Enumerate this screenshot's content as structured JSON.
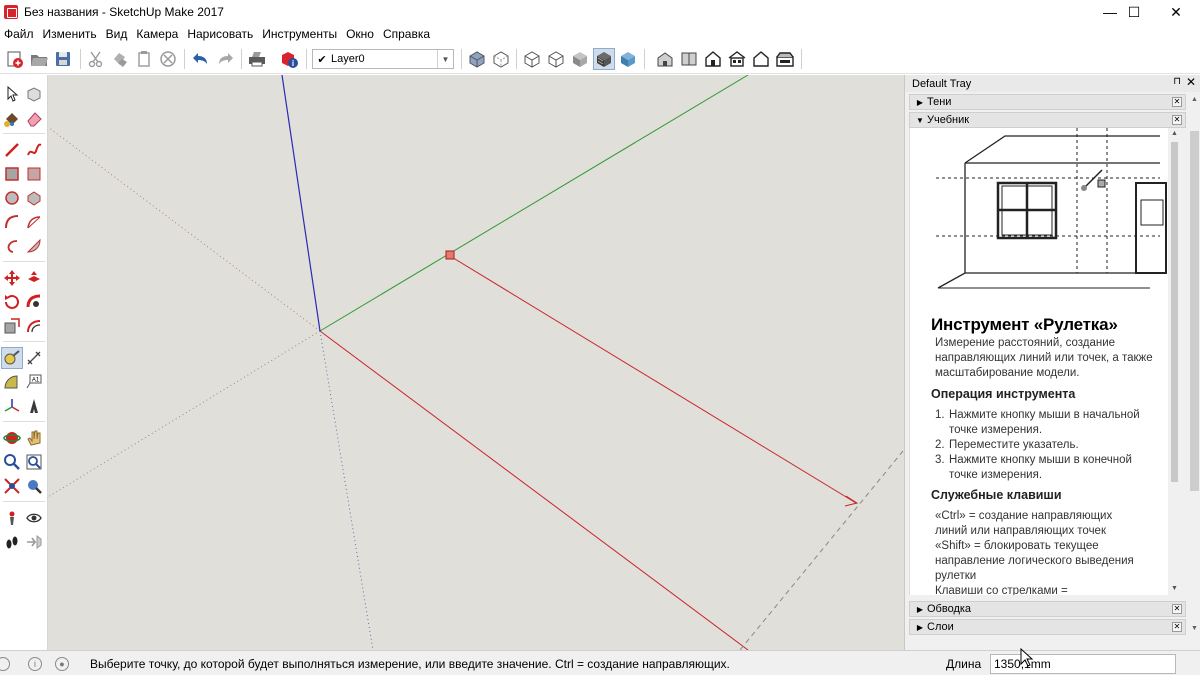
{
  "window": {
    "title": "Без названия - SketchUp Make 2017",
    "minimize": "—",
    "maximize": "☐",
    "close": "✕"
  },
  "menu": [
    "Файл",
    "Изменить",
    "Вид",
    "Камера",
    "Нарисовать",
    "Инструменты",
    "Окно",
    "Справка"
  ],
  "toolbar": {
    "layer_check": "✔",
    "layer_value": "Layer0",
    "layer_dropdown": "▼",
    "icons": [
      "new-file-icon",
      "open-file-icon",
      "save-icon",
      "cut-icon",
      "copy-icon",
      "paste-icon",
      "erase-icon",
      "undo-icon",
      "redo-icon",
      "print-icon",
      "model-info-icon",
      "xray-style-icon",
      "backedges-style-icon",
      "wireframe-style-icon",
      "hiddenline-style-icon",
      "shaded-style-icon",
      "shaded-textures-style-icon",
      "monochrome-style-icon",
      "iso-view-icon",
      "top-view-icon",
      "front-view-icon",
      "right-view-icon",
      "back-view-icon",
      "left-view-icon"
    ]
  },
  "tray": {
    "title": "Default Tray",
    "pin": "⊓",
    "close": "✕",
    "panels": {
      "shadows": "Тени",
      "instructor": "Учебник",
      "outline": "Обводка",
      "layers": "Слои"
    },
    "arrow_collapsed": "▶",
    "arrow_expanded": "▼",
    "panel_close": "✕"
  },
  "instructor": {
    "title": "Инструмент «Рулетка»",
    "description": "Измерение расстояний, создание направляющих линий или точек, а также масштабирование модели.",
    "operation_heading": "Операция инструмента",
    "steps": [
      {
        "num": "1.",
        "text": "Нажмите кнопку мыши в начальной точке измерения."
      },
      {
        "num": "2.",
        "text": "Переместите указатель."
      },
      {
        "num": "3.",
        "text": "Нажмите кнопку мыши в конечной точке измерения."
      }
    ],
    "keys_heading": "Служебные клавиши",
    "keys": [
      "«Ctrl» = создание направляющих",
      "линий или направляющих точек",
      "«Shift» = блокировать текущее",
      "направление логического выведения",
      "рулетки",
      "Клавиши со стрелками ="
    ]
  },
  "statusbar": {
    "message": "Выберите точку, до которой будет выполняться измерение, или введите значение.  Ctrl = создание направляющих.",
    "value_label": "Длина",
    "value": "1350,1mm",
    "info_icon": "i",
    "user_icon": "●"
  },
  "colors": {
    "viewport_bg": "#e1dfda",
    "axis_red": "#c8242a",
    "axis_green": "#2e9a2e",
    "axis_blue": "#2a2ab8",
    "brand_red": "#d8232a"
  }
}
